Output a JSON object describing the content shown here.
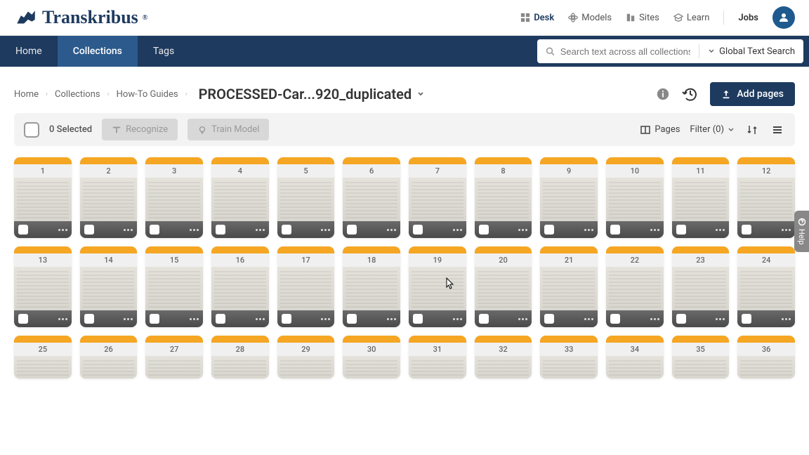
{
  "brand": {
    "name": "Transkribus"
  },
  "topnav": {
    "desk": "Desk",
    "models": "Models",
    "sites": "Sites",
    "learn": "Learn",
    "jobs": "Jobs"
  },
  "mainnav": {
    "home": "Home",
    "collections": "Collections",
    "tags": "Tags"
  },
  "search": {
    "placeholder": "Search text across all collections",
    "scope": "Global Text Search"
  },
  "breadcrumb": {
    "home": "Home",
    "collections": "Collections",
    "guides": "How-To Guides",
    "title": "PROCESSED-Car...920_duplicated"
  },
  "actions": {
    "add_pages": "Add pages"
  },
  "toolbar": {
    "selected": "0 Selected",
    "recognize": "Recognize",
    "train": "Train Model",
    "pages": "Pages",
    "filter": "Filter (0)"
  },
  "help": {
    "label": "Help"
  },
  "pages": [
    {
      "n": "1"
    },
    {
      "n": "2"
    },
    {
      "n": "3"
    },
    {
      "n": "4"
    },
    {
      "n": "5"
    },
    {
      "n": "6"
    },
    {
      "n": "7"
    },
    {
      "n": "8"
    },
    {
      "n": "9"
    },
    {
      "n": "10"
    },
    {
      "n": "11"
    },
    {
      "n": "12"
    },
    {
      "n": "13"
    },
    {
      "n": "14"
    },
    {
      "n": "15"
    },
    {
      "n": "16"
    },
    {
      "n": "17"
    },
    {
      "n": "18"
    },
    {
      "n": "19"
    },
    {
      "n": "20"
    },
    {
      "n": "21"
    },
    {
      "n": "22"
    },
    {
      "n": "23"
    },
    {
      "n": "24"
    },
    {
      "n": "25"
    },
    {
      "n": "26"
    },
    {
      "n": "27"
    },
    {
      "n": "28"
    },
    {
      "n": "29"
    },
    {
      "n": "30"
    },
    {
      "n": "31"
    },
    {
      "n": "32"
    },
    {
      "n": "33"
    },
    {
      "n": "34"
    },
    {
      "n": "35"
    },
    {
      "n": "36"
    }
  ]
}
